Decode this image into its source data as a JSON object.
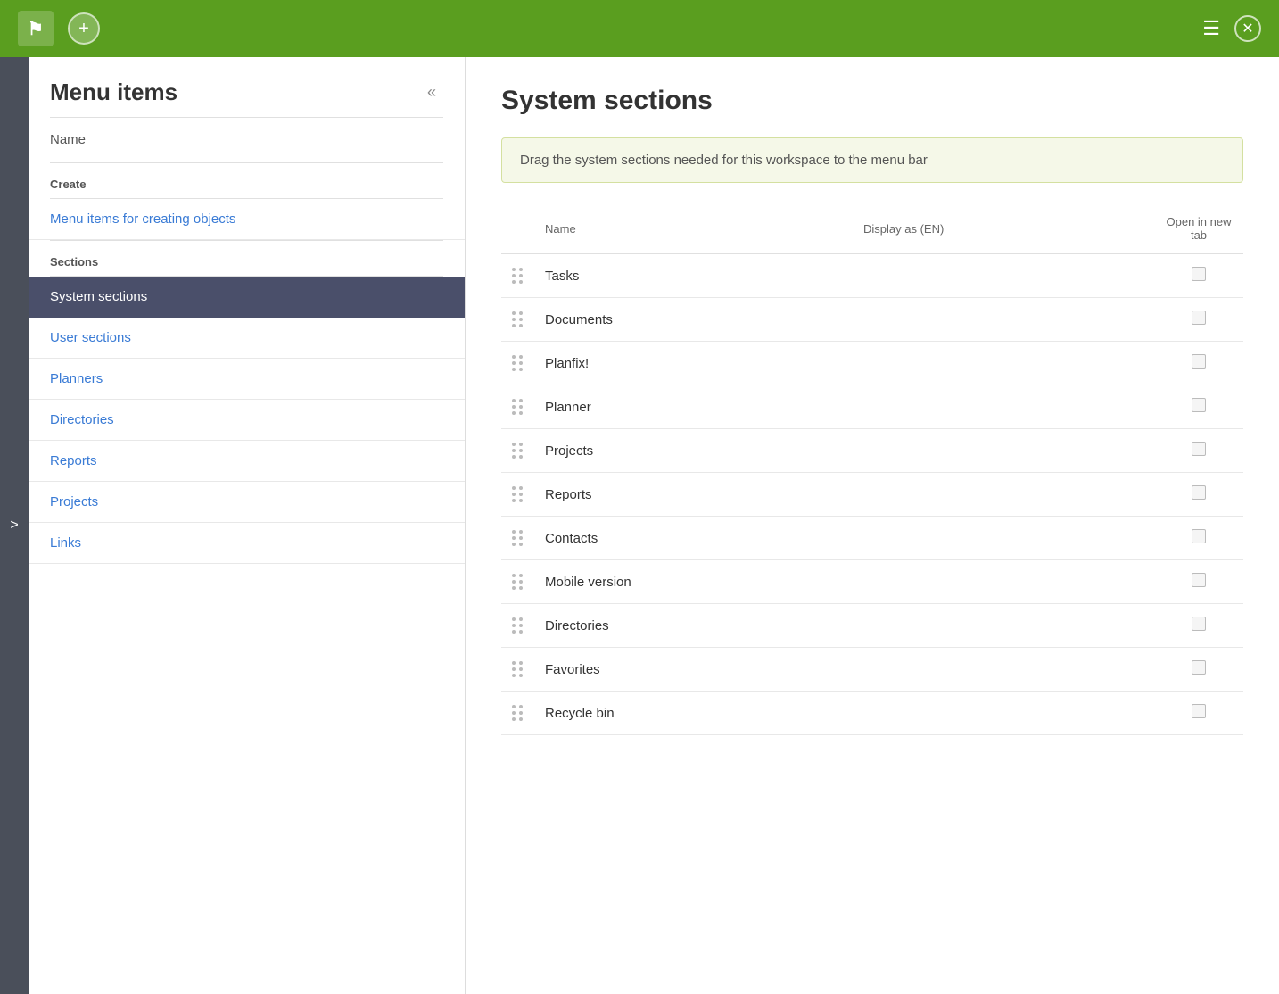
{
  "topbar": {
    "add_label": "+",
    "logo_text": "⚑",
    "menu_icon": "☰",
    "close_icon": "✕"
  },
  "left_panel": {
    "title": "Menu items",
    "collapse_icon": "«",
    "name_section": {
      "label": "Name"
    },
    "create_group": {
      "label": "Create",
      "items": [
        {
          "id": "menu-items-creating",
          "label": "Menu items for creating objects",
          "active": false
        }
      ]
    },
    "sections_group": {
      "label": "Sections",
      "items": [
        {
          "id": "system-sections",
          "label": "System sections",
          "active": true
        },
        {
          "id": "user-sections",
          "label": "User sections",
          "active": false
        },
        {
          "id": "planners",
          "label": "Planners",
          "active": false
        },
        {
          "id": "directories",
          "label": "Directories",
          "active": false
        },
        {
          "id": "reports",
          "label": "Reports",
          "active": false
        },
        {
          "id": "projects",
          "label": "Projects",
          "active": false
        },
        {
          "id": "links",
          "label": "Links",
          "active": false
        }
      ]
    }
  },
  "right_panel": {
    "title": "System sections",
    "info_message": "Drag the system sections needed for this workspace to the menu bar",
    "table": {
      "headers": {
        "name": "Name",
        "display_as": "Display as (EN)",
        "open_in_new_tab": "Open in new tab"
      },
      "rows": [
        {
          "name": "Tasks",
          "display_as": "",
          "checked": false
        },
        {
          "name": "Documents",
          "display_as": "",
          "checked": false
        },
        {
          "name": "Planfix!",
          "display_as": "",
          "checked": false
        },
        {
          "name": "Planner",
          "display_as": "",
          "checked": false
        },
        {
          "name": "Projects",
          "display_as": "",
          "checked": false
        },
        {
          "name": "Reports",
          "display_as": "",
          "checked": false
        },
        {
          "name": "Contacts",
          "display_as": "",
          "checked": false
        },
        {
          "name": "Mobile version",
          "display_as": "",
          "checked": false
        },
        {
          "name": "Directories",
          "display_as": "",
          "checked": false
        },
        {
          "name": "Favorites",
          "display_as": "",
          "checked": false
        },
        {
          "name": "Recycle bin",
          "display_as": "",
          "checked": false
        }
      ]
    }
  },
  "colors": {
    "topbar_green": "#5a9e1f",
    "sidebar_active": "#4a4f6a",
    "link_blue": "#3a7bd5"
  }
}
